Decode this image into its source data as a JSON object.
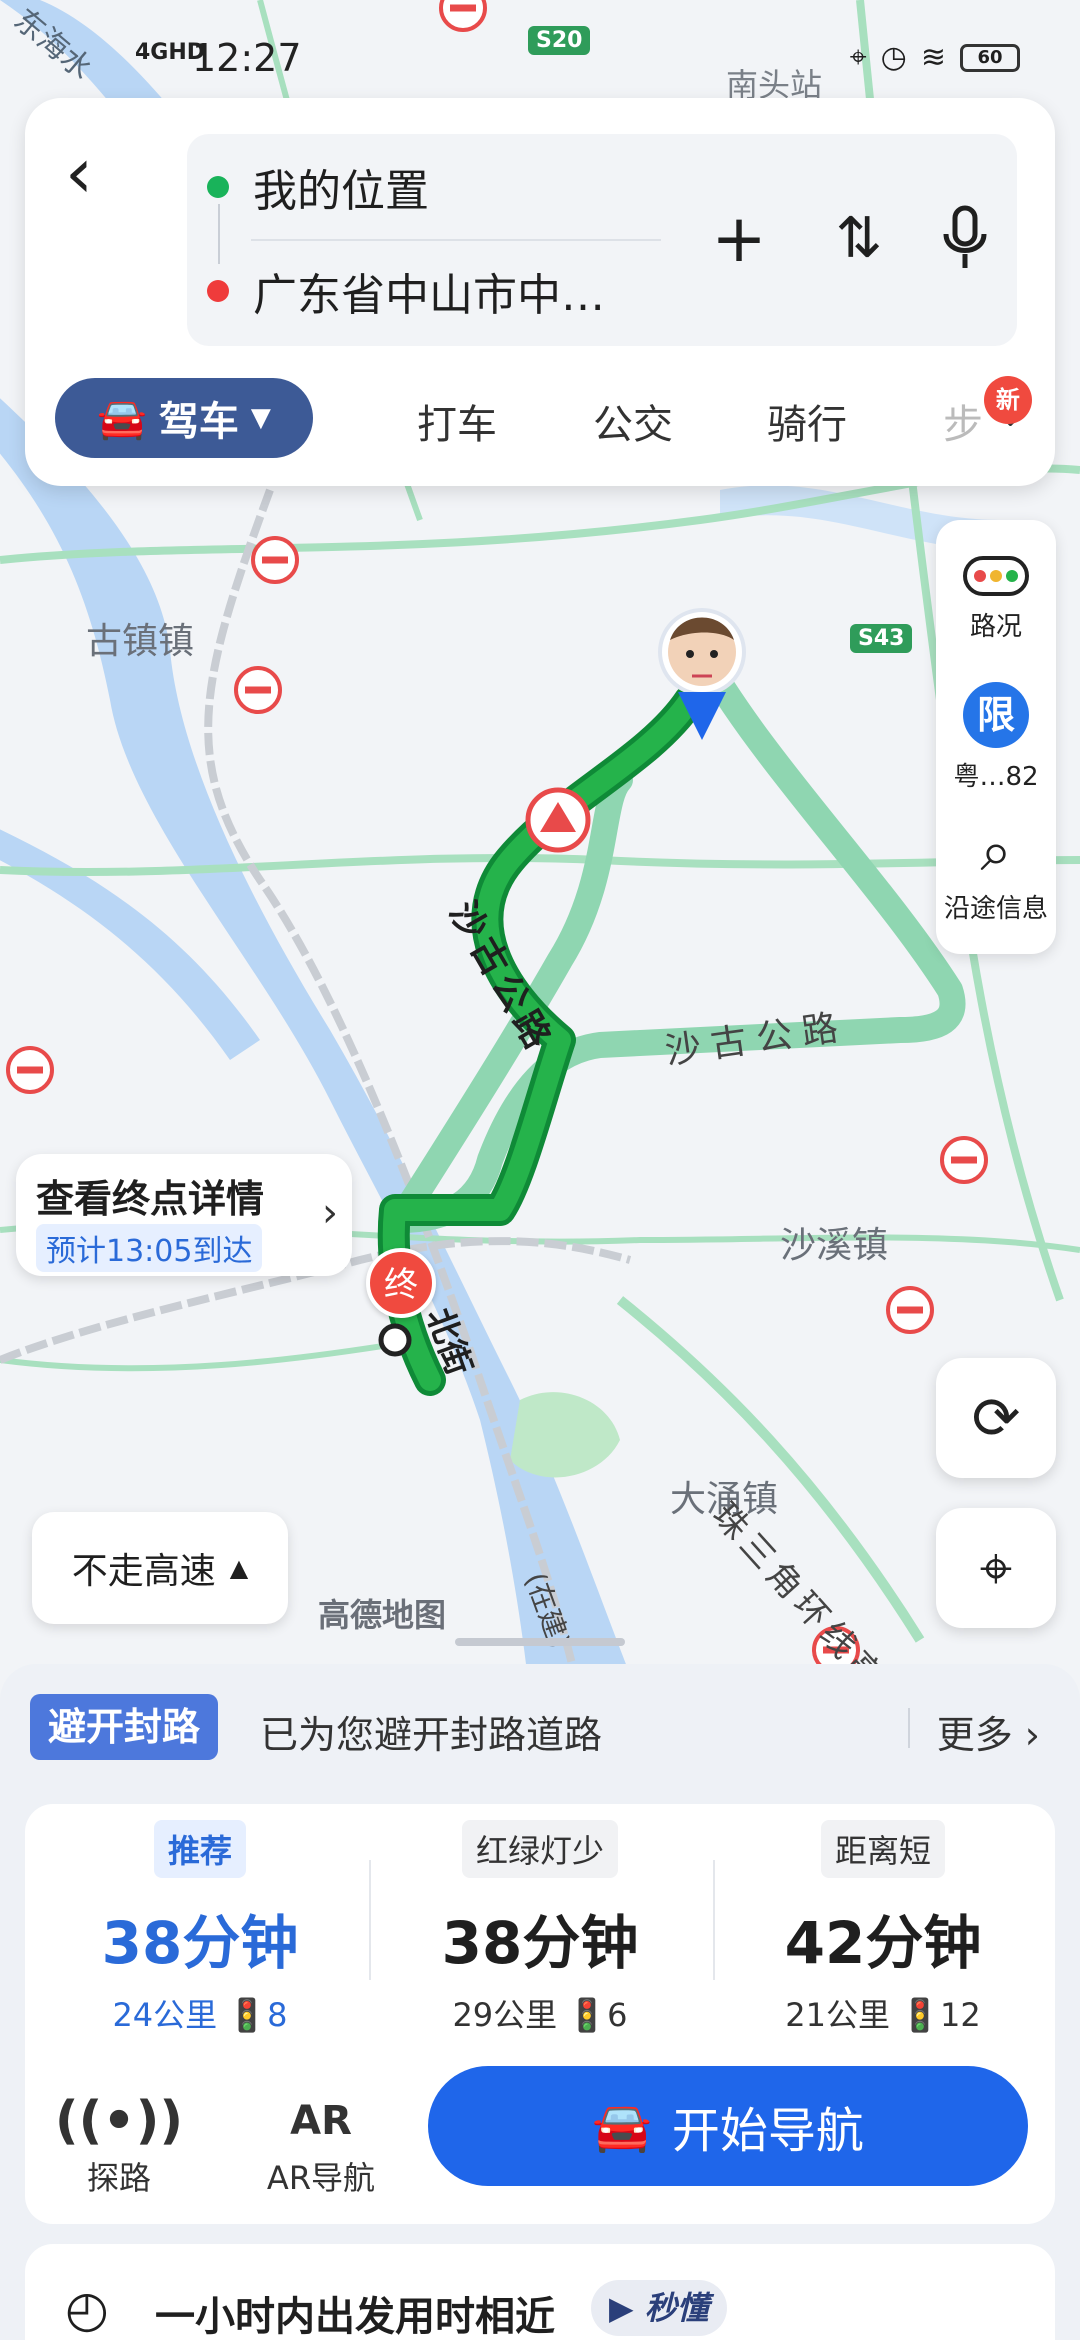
{
  "status": {
    "time": "12:27",
    "network": "4GHD",
    "battery": "60"
  },
  "search": {
    "origin": "我的位置",
    "destination": "广东省中山市中…"
  },
  "modes": {
    "active": "驾车",
    "items": [
      "打车",
      "公交",
      "骑行",
      "步"
    ],
    "new_badge": "新"
  },
  "side": {
    "traffic": "路况",
    "restrict_icon": "限",
    "restrict": "粤…82",
    "along": "沿途信息"
  },
  "map": {
    "labels": {
      "guzhen": "古镇镇",
      "shaxi": "沙溪镇",
      "datong": "大涌镇",
      "nantou": "南头站",
      "shagu": "沙古公路",
      "shagu2": "沙古公路",
      "zhusanjiao": "珠三角环线高速",
      "beijie": "北街",
      "zaijian": "(在建)",
      "s20": "S20",
      "s43": "S43",
      "donghai": "东海水"
    },
    "watermark": "高德地图",
    "destination_marker": "终"
  },
  "destination": {
    "title": "查看终点详情",
    "eta": "预计13:05到达"
  },
  "no_highway": "不走高速",
  "avoid": {
    "tag": "避开封路",
    "text": "已为您避开封路道路",
    "more": "更多"
  },
  "routes": [
    {
      "tag": "推荐",
      "time": "38分钟",
      "sub": "24公里 🚦8"
    },
    {
      "tag": "红绿灯少",
      "time": "38分钟",
      "sub": "29公里 🚦6"
    },
    {
      "tag": "距离短",
      "time": "42分钟",
      "sub": "21公里 🚦12"
    }
  ],
  "actions": {
    "probe": "探路",
    "ar": "AR导航",
    "ar_icon": "AR",
    "start": "开始导航"
  },
  "bottom": {
    "text": "一小时内出发用时相近",
    "badge": "秒懂"
  },
  "colors": {
    "route_green": "#25b34b",
    "route_alt": "#8fd6b1",
    "accent": "#1f66ea"
  }
}
